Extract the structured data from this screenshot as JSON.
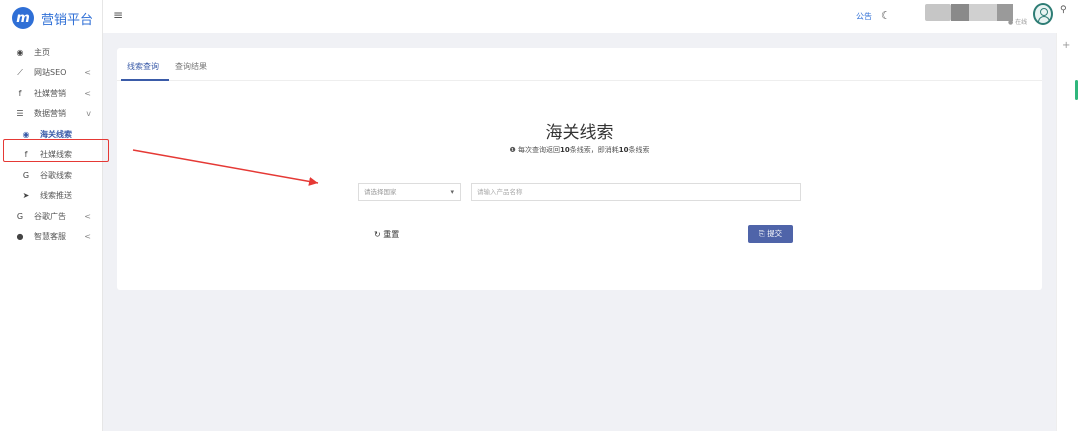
{
  "app": {
    "logo_letter": "m",
    "title": "营销平台"
  },
  "sidebar": {
    "items": [
      {
        "icon": "dashboard-icon",
        "glyph": "◉",
        "label": "主页"
      },
      {
        "icon": "chart-line-icon",
        "glyph": "⟋",
        "label": "网站SEO",
        "arrow": "<"
      },
      {
        "icon": "facebook-icon",
        "glyph": "f",
        "label": "社媒营销",
        "arrow": "<"
      },
      {
        "icon": "database-icon",
        "glyph": "☰",
        "label": "数据营销",
        "arrow": "v"
      }
    ],
    "subitems": [
      {
        "icon": "globe-icon",
        "glyph": "◉",
        "label": "海关线索"
      },
      {
        "icon": "facebook-icon",
        "glyph": "f",
        "label": "社媒线索"
      },
      {
        "icon": "google-icon",
        "glyph": "G",
        "label": "谷歌线索"
      },
      {
        "icon": "send-icon",
        "glyph": "➤",
        "label": "线索推送"
      }
    ],
    "items2": [
      {
        "icon": "google-icon",
        "glyph": "G",
        "label": "谷歌广告",
        "arrow": "<"
      },
      {
        "icon": "wechat-icon",
        "glyph": "●",
        "label": "智慧客服",
        "arrow": "<"
      }
    ]
  },
  "topbar": {
    "menu_glyph": "≡",
    "notice": "公告",
    "moon_glyph": "☾",
    "online": "● 在线",
    "search_glyph": "⚲",
    "plus_glyph": "+"
  },
  "tabs": [
    {
      "label": "线索查询"
    },
    {
      "label": "查询结果"
    }
  ],
  "main": {
    "title": "海关线索",
    "subtitle_icon": "❶",
    "subtitle_prefix": "每次查询返回",
    "subtitle_b1": "10",
    "subtitle_mid": "条线索，即消耗",
    "subtitle_b2": "10",
    "subtitle_suffix": "条线索",
    "country_placeholder": "请选择国家",
    "product_placeholder": "请输入产品名称",
    "reset_label": "重置",
    "reset_glyph": "↻",
    "submit_label": "提交",
    "submit_glyph": "⎘"
  },
  "colors": {
    "accent": "#3a5ba8",
    "annotation": "#e53935",
    "brand": "#2f6fd6"
  }
}
